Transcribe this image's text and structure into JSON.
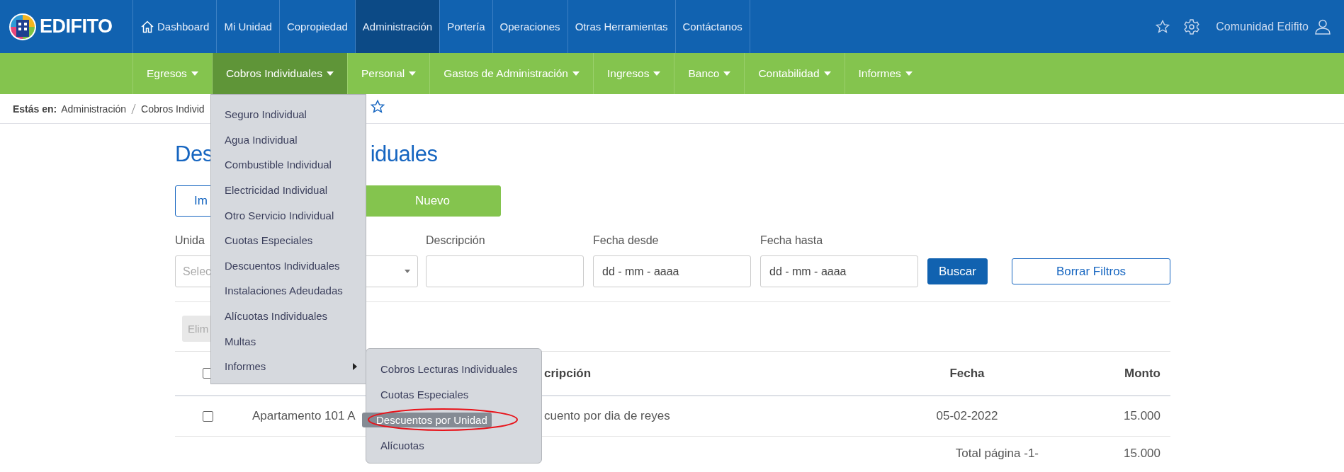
{
  "brand": {
    "name": "EDIFITO"
  },
  "top_nav": [
    {
      "label": "Dashboard",
      "kind": "home",
      "selected": false
    },
    {
      "label": "Mi Unidad",
      "kind": "text",
      "selected": false
    },
    {
      "label": "Copropiedad",
      "kind": "text",
      "selected": false
    },
    {
      "label": "Administración",
      "kind": "text",
      "selected": true
    },
    {
      "label": "Portería",
      "kind": "text",
      "selected": false
    },
    {
      "label": "Operaciones",
      "kind": "text",
      "selected": false
    },
    {
      "label": "Otras Herramientas",
      "kind": "text",
      "selected": false
    },
    {
      "label": "Contáctanos",
      "kind": "text",
      "selected": false
    }
  ],
  "user": {
    "name": "Comunidad Edifito"
  },
  "sub_nav": [
    {
      "label": "Egresos",
      "selected": false
    },
    {
      "label": "Cobros Individuales",
      "selected": true
    },
    {
      "label": "Personal",
      "selected": false
    },
    {
      "label": "Gastos de Administración",
      "selected": false
    },
    {
      "label": "Ingresos",
      "selected": false
    },
    {
      "label": "Banco",
      "selected": false
    },
    {
      "label": "Contabilidad",
      "selected": false
    },
    {
      "label": "Informes",
      "selected": false
    }
  ],
  "breadcrumb": {
    "prefix": "Estás en:",
    "items": [
      "Administración",
      "Cobros Individ"
    ]
  },
  "page_title": [
    "Des",
    "iduales"
  ],
  "actions": [
    {
      "label": "Im",
      "kind": "outline"
    },
    {
      "label": "Nuevo",
      "kind": "primary"
    }
  ],
  "filters": [
    {
      "kind": "select",
      "label": "Unida",
      "placeholder": "Selec"
    },
    {
      "kind": "text",
      "label": "Descripción"
    },
    {
      "kind": "date",
      "label": "Fecha desde",
      "placeholder": "dd - mm - aaaa"
    },
    {
      "kind": "date",
      "label": "Fecha hasta",
      "placeholder": "dd - mm - aaaa"
    }
  ],
  "filter_buttons": [
    {
      "label": "Buscar",
      "kind": "primary"
    },
    {
      "label": "Borrar Filtros",
      "kind": "outline"
    }
  ],
  "bulk_action": {
    "label": "Elim",
    "disabled": true
  },
  "table": {
    "select_all": {
      "checked": false
    },
    "columns": [
      "cripción",
      "Fecha",
      "Monto"
    ],
    "rows": [
      {
        "checked": false,
        "unit": "Apartamento 101 A",
        "description": "cuento por dia de reyes",
        "date": "05-02-2022",
        "amount": "15.000"
      }
    ],
    "total": {
      "label": "Total página -1-",
      "amount": "15.000"
    }
  },
  "dropdown": {
    "items": [
      {
        "label": "Seguro Individual",
        "has_submenu": false
      },
      {
        "label": "Agua Individual",
        "has_submenu": false
      },
      {
        "label": "Combustible Individual",
        "has_submenu": false
      },
      {
        "label": "Electricidad Individual",
        "has_submenu": false
      },
      {
        "label": "Otro Servicio Individual",
        "has_submenu": false
      },
      {
        "label": "Cuotas Especiales",
        "has_submenu": false
      },
      {
        "label": "Descuentos Individuales",
        "has_submenu": false
      },
      {
        "label": "Instalaciones Adeudadas",
        "has_submenu": false
      },
      {
        "label": "Alícuotas Individuales",
        "has_submenu": false
      },
      {
        "label": "Multas",
        "has_submenu": false
      },
      {
        "label": "Informes",
        "has_submenu": true
      }
    ]
  },
  "submenu": {
    "items": [
      {
        "label": "Cobros Lecturas Individuales",
        "selected": false,
        "circled": false
      },
      {
        "label": "Cuotas Especiales",
        "selected": false,
        "circled": false
      },
      {
        "label": "Descuentos por Unidad",
        "selected": true,
        "circled": true
      },
      {
        "label": "Alícuotas",
        "selected": false,
        "circled": false
      }
    ]
  }
}
